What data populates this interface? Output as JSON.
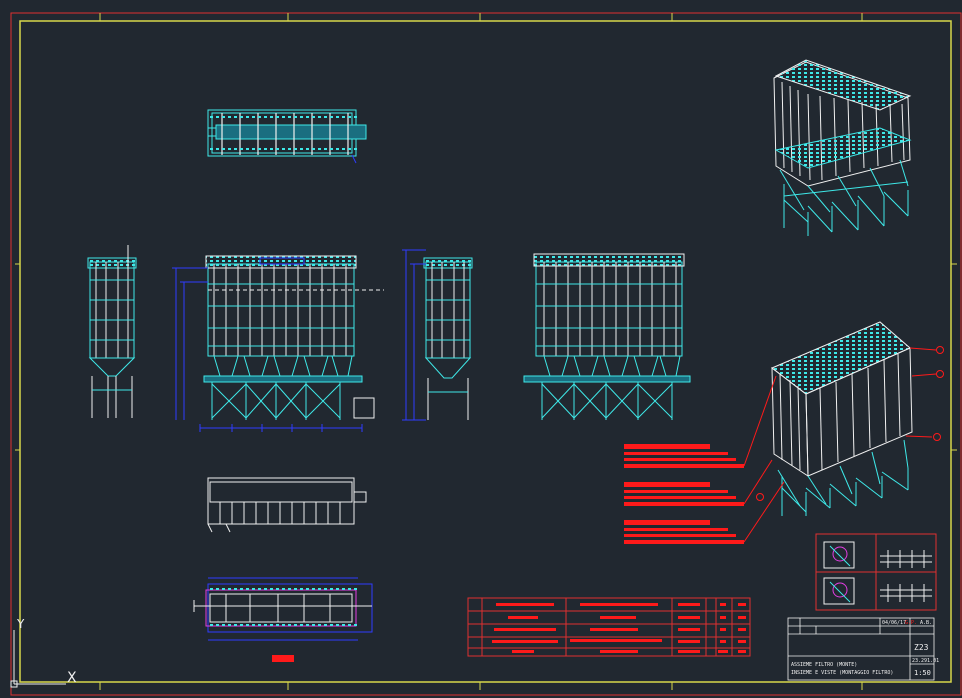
{
  "colors": {
    "background": "#212830",
    "frame_red": "#e03030",
    "frame_yellow": "#d8d84a",
    "steel": "#3ee8e8",
    "dimension": "#2f3cff",
    "annotation": "#ff1a1a",
    "detail_magenta": "#e23ee2",
    "white": "#f0f0f0"
  },
  "ucs": {
    "y_axis_label": "Y",
    "x_axis_label": "X"
  },
  "views": [
    {
      "name": "top-view"
    },
    {
      "name": "side-view-left"
    },
    {
      "name": "front-view"
    },
    {
      "name": "side-view-right"
    },
    {
      "name": "rear-view"
    },
    {
      "name": "iso-view-upper"
    },
    {
      "name": "iso-view-lower"
    },
    {
      "name": "plan-view"
    },
    {
      "name": "foundation-plan-view"
    }
  ],
  "title_block": {
    "drawing_number": "Z23",
    "date": "04/06/17",
    "project_code": "23.291.01",
    "scale": "1:50",
    "title_line_1": "ASSIEME FILTRO (MONTE)",
    "title_line_2": "INSIEME E VISTE (MONTAGGIO FILTRO)",
    "designed_label": "G.P.",
    "checked_label": "A.B."
  }
}
